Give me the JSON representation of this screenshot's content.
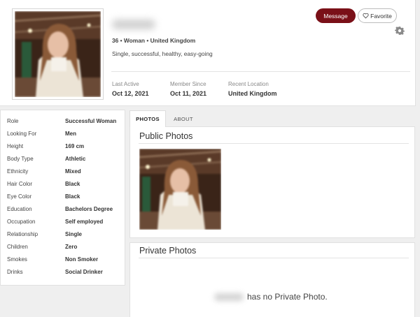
{
  "profile": {
    "summary": "36 • Woman • United Kingdom",
    "tagline": "Single, successful, healthy, easy-going",
    "stats": [
      {
        "label": "Last Active",
        "value": "Oct 12, 2021"
      },
      {
        "label": "Member Since",
        "value": "Oct 11, 2021"
      },
      {
        "label": "Recent Location",
        "value": "United Kingdom"
      }
    ],
    "actions": {
      "message": "Message",
      "favorite": "Favorite"
    }
  },
  "details": [
    {
      "label": "Role",
      "value": "Successful Woman"
    },
    {
      "label": "Looking For",
      "value": "Men"
    },
    {
      "label": "Height",
      "value": "169 cm"
    },
    {
      "label": "Body Type",
      "value": "Athletic"
    },
    {
      "label": "Ethnicity",
      "value": "Mixed"
    },
    {
      "label": "Hair Color",
      "value": "Black"
    },
    {
      "label": "Eye Color",
      "value": "Black"
    },
    {
      "label": "Education",
      "value": "Bachelors Degree"
    },
    {
      "label": "Occupation",
      "value": "Self employed"
    },
    {
      "label": "Relationship",
      "value": "Single"
    },
    {
      "label": "Children",
      "value": "Zero"
    },
    {
      "label": "Smokes",
      "value": "Non Smoker"
    },
    {
      "label": "Drinks",
      "value": "Social Drinker"
    }
  ],
  "tabs": [
    {
      "label": "PHOTOS",
      "active": true
    },
    {
      "label": "ABOUT",
      "active": false
    }
  ],
  "public_photos": {
    "title": "Public Photos"
  },
  "private_photos": {
    "title": "Private Photos",
    "empty_message": "has no Private Photo."
  },
  "colors": {
    "accent": "#7a1018",
    "page_bg": "#efefef"
  },
  "icons": {
    "favorite": "heart-icon",
    "settings": "gear-icon"
  }
}
